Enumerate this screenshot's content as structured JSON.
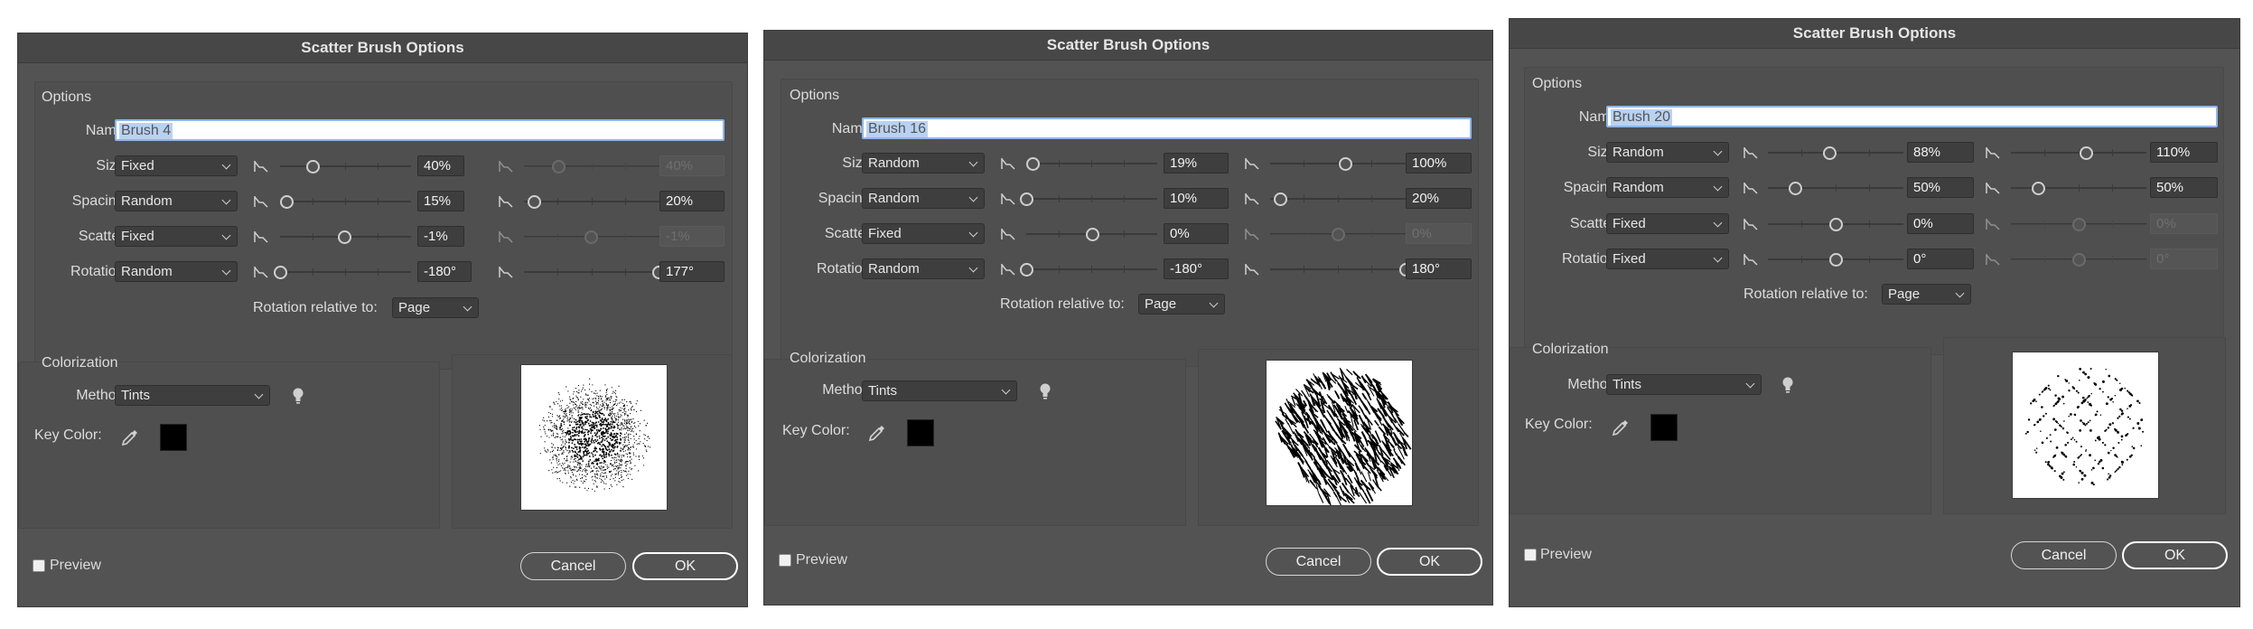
{
  "dialogs": [
    {
      "title": "Scatter Brush Options",
      "options_label": "Options",
      "name_label": "Name:",
      "name_value": "Brush 4",
      "rows": [
        {
          "label": "Size:",
          "mode": "Fixed",
          "min": "40%",
          "max": "40%",
          "min_level": 0.25,
          "max_level": 0.25,
          "max_enabled": false
        },
        {
          "label": "Spacing:",
          "mode": "Random",
          "min": "15%",
          "max": "20%",
          "min_level": 0.05,
          "max_level": 0.07,
          "max_enabled": true
        },
        {
          "label": "Scatter:",
          "mode": "Fixed",
          "min": "-1%",
          "max": "-1%",
          "min_level": 0.49,
          "max_level": 0.49,
          "max_enabled": false
        },
        {
          "label": "Rotation:",
          "mode": "Random",
          "min": "-180°",
          "max": "177°",
          "min_level": 0.0,
          "max_level": 0.99,
          "max_enabled": true
        }
      ],
      "rotation_relative_label": "Rotation relative to:",
      "rotation_relative_value": "Page",
      "colorization_label": "Colorization",
      "method_label": "Method:",
      "method_value": "Tints",
      "key_color_label": "Key Color:",
      "key_color": "#000000",
      "preview_label": "Preview",
      "cancel_label": "Cancel",
      "ok_label": "OK"
    },
    {
      "title": "Scatter Brush Options",
      "options_label": "Options",
      "name_label": "Name:",
      "name_value": "Brush 16",
      "rows": [
        {
          "label": "Size:",
          "mode": "Random",
          "min": "19%",
          "max": "100%",
          "min_level": 0.05,
          "max_level": 0.55,
          "max_enabled": true
        },
        {
          "label": "Spacing:",
          "mode": "Random",
          "min": "10%",
          "max": "20%",
          "min_level": 0.0,
          "max_level": 0.07,
          "max_enabled": true
        },
        {
          "label": "Scatter:",
          "mode": "Fixed",
          "min": "0%",
          "max": "0%",
          "min_level": 0.5,
          "max_level": 0.5,
          "max_enabled": false
        },
        {
          "label": "Rotation:",
          "mode": "Random",
          "min": "-180°",
          "max": "180°",
          "min_level": 0.0,
          "max_level": 1.0,
          "max_enabled": true
        }
      ],
      "rotation_relative_label": "Rotation relative to:",
      "rotation_relative_value": "Page",
      "colorization_label": "Colorization",
      "method_label": "Method:",
      "method_value": "Tints",
      "key_color_label": "Key Color:",
      "key_color": "#000000",
      "preview_label": "Preview",
      "cancel_label": "Cancel",
      "ok_label": "OK"
    },
    {
      "title": "Scatter Brush Options",
      "options_label": "Options",
      "name_label": "Name:",
      "name_value": "Brush 20",
      "rows": [
        {
          "label": "Size:",
          "mode": "Random",
          "min": "88%",
          "max": "110%",
          "min_level": 0.45,
          "max_level": 0.55,
          "max_enabled": true
        },
        {
          "label": "Spacing:",
          "mode": "Random",
          "min": "50%",
          "max": "50%",
          "min_level": 0.2,
          "max_level": 0.2,
          "max_enabled": true
        },
        {
          "label": "Scatter:",
          "mode": "Fixed",
          "min": "0%",
          "max": "0%",
          "min_level": 0.5,
          "max_level": 0.5,
          "max_enabled": false
        },
        {
          "label": "Rotation:",
          "mode": "Fixed",
          "min": "0°",
          "max": "0°",
          "min_level": 0.5,
          "max_level": 0.5,
          "max_enabled": false
        }
      ],
      "rotation_relative_label": "Rotation relative to:",
      "rotation_relative_value": "Page",
      "colorization_label": "Colorization",
      "method_label": "Method:",
      "method_value": "Tints",
      "key_color_label": "Key Color:",
      "key_color": "#000000",
      "preview_label": "Preview",
      "cancel_label": "Cancel",
      "ok_label": "OK"
    }
  ]
}
